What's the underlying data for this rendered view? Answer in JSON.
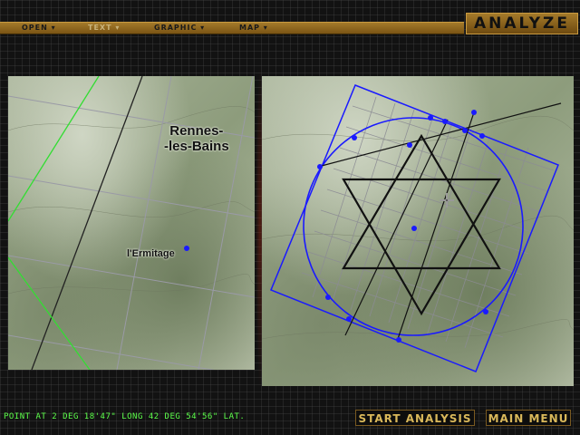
{
  "menu": {
    "items": [
      {
        "label": "OPEN ▾",
        "enabled": true
      },
      {
        "label": "TEXT ▾",
        "enabled": false
      },
      {
        "label": "GRAPHIC ▾",
        "enabled": true
      },
      {
        "label": "MAP ▾",
        "enabled": true
      }
    ]
  },
  "title": "ANALYZE",
  "left_map": {
    "labels": {
      "rennes": "Rennes-\n-les-Bains",
      "ermitage": "l'Ermitage"
    }
  },
  "status": {
    "text": "POINT AT 2 DEG 18'47\" LONG  42 DEG 54'56\" LAT."
  },
  "buttons": {
    "start_analysis": "START ANALYSIS",
    "main_menu": "MAIN MENU"
  },
  "colors": {
    "accent": "#a47a2a",
    "button_text": "#d9b85a",
    "status_text": "#5cff4a",
    "overlay_blue": "#1a1aff",
    "overlay_green": "#33dd33"
  },
  "icons": {
    "cursor": "move-cursor-icon"
  }
}
